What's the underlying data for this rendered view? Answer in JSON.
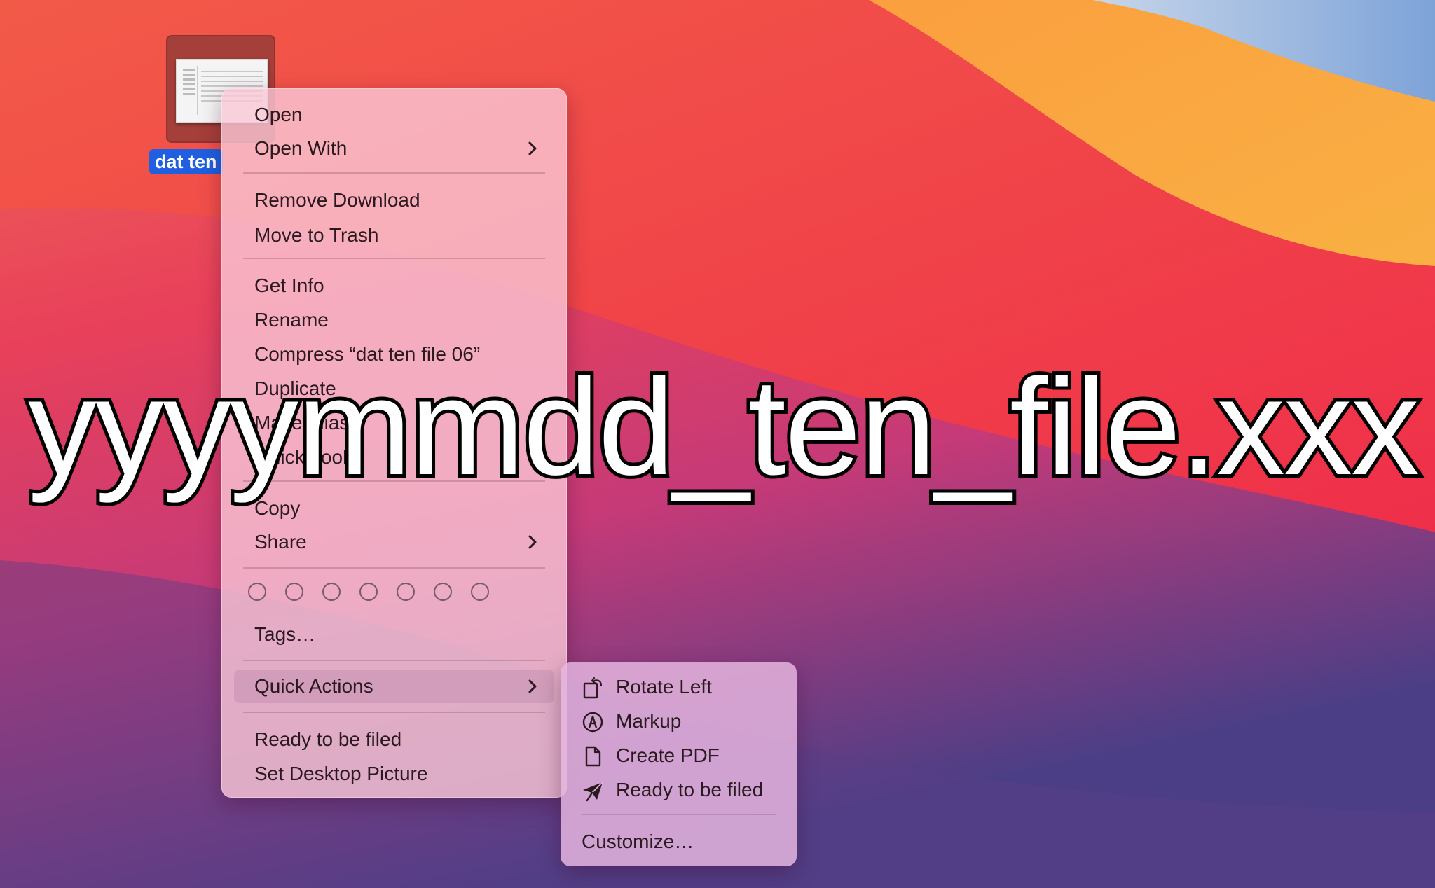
{
  "desktop": {
    "file_label": "dat ten"
  },
  "context_menu": {
    "groups": [
      [
        "Open",
        "Open With"
      ],
      [
        "Remove Download",
        "Move to Trash"
      ],
      [
        "Get Info",
        "Rename",
        "Compress “dat ten file 06”",
        "Duplicate",
        "Make Alias",
        "Quick Look"
      ],
      [
        "Copy",
        "Share"
      ],
      [
        "Tags…"
      ],
      [
        "Quick Actions"
      ],
      [
        "Ready to be filed",
        "Set Desktop Picture"
      ]
    ],
    "open": "Open",
    "open_with": "Open With",
    "remove_download": "Remove Download",
    "move_to_trash": "Move to Trash",
    "get_info": "Get Info",
    "rename": "Rename",
    "compress": "Compress “dat ten file 06”",
    "duplicate": "Duplicate",
    "make_alias": "Make Alias",
    "quick_look": "Quick Look",
    "copy": "Copy",
    "share": "Share",
    "tags": "Tags…",
    "quick_actions": "Quick Actions",
    "ready_to_be_filed": "Ready to be filed",
    "set_desktop_picture": "Set Desktop Picture",
    "tag_colors_count": 7
  },
  "quick_actions_submenu": {
    "rotate_left": "Rotate Left",
    "markup": "Markup",
    "create_pdf": "Create PDF",
    "ready_to_be_filed": "Ready to be filed",
    "customize": "Customize…"
  },
  "overlay_caption": "yyyymmdd_ten_file.xxx",
  "colors": {
    "selection_blue": "#1f5fe0",
    "menu_bg": "#fac8d7",
    "submenu_bg": "#e4b4de"
  }
}
